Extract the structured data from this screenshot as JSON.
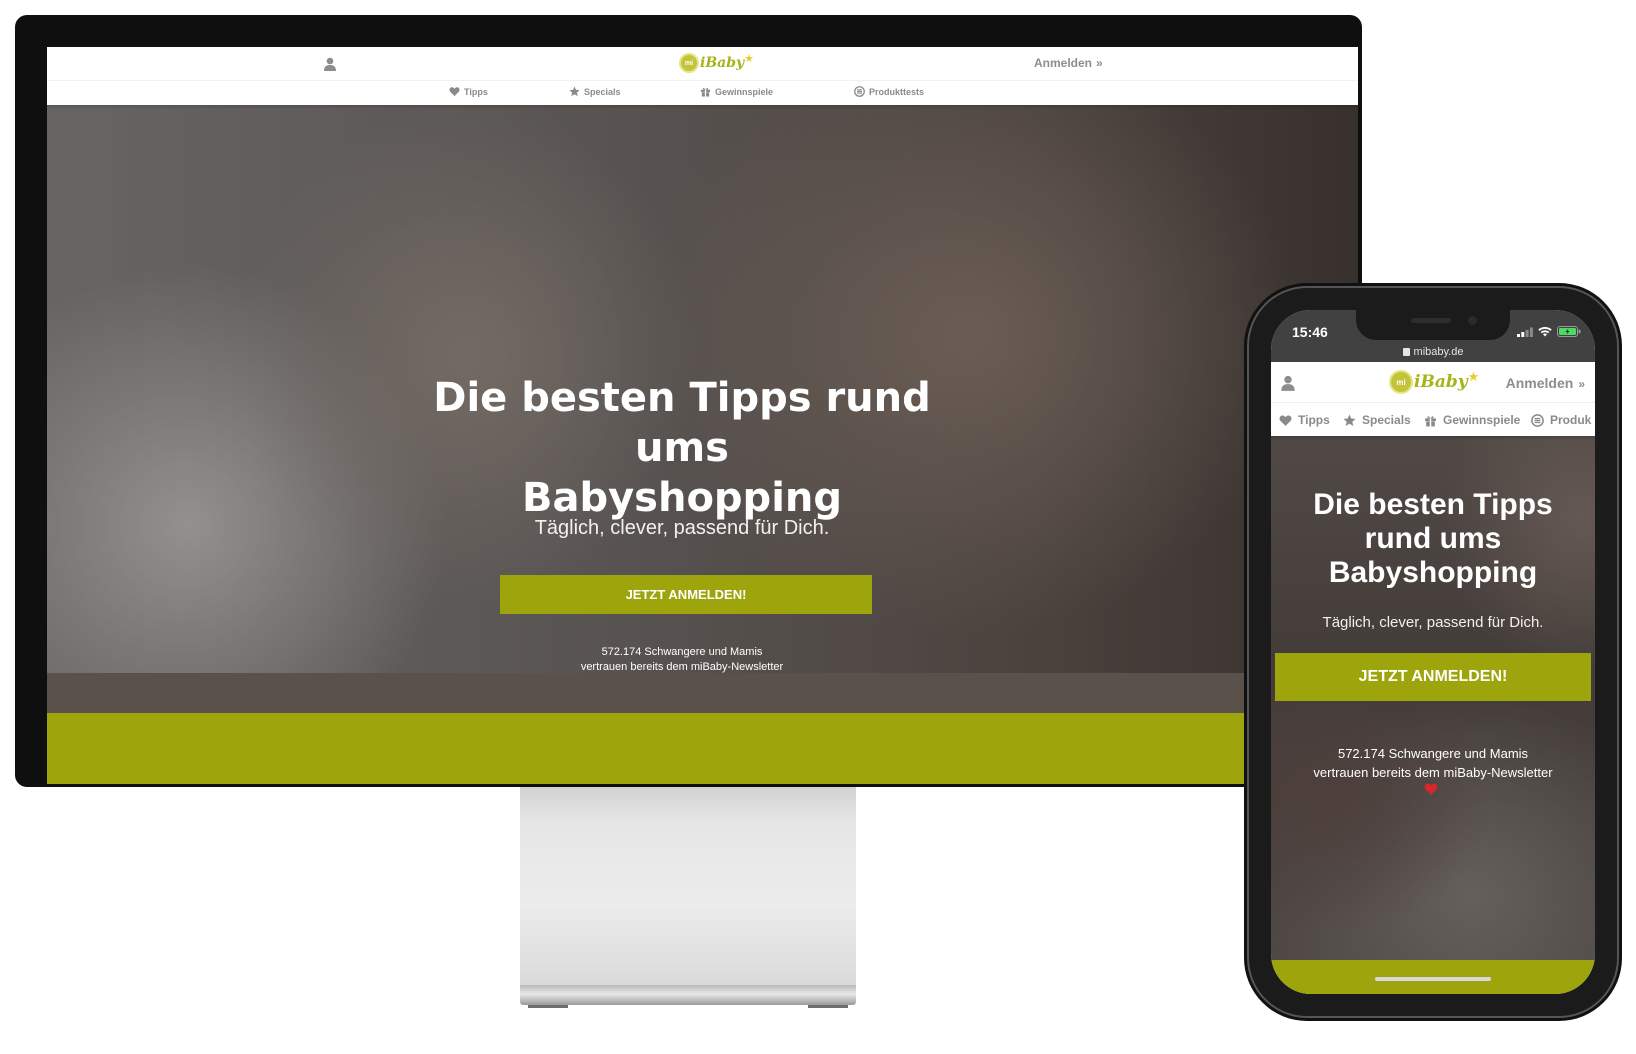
{
  "desktop": {
    "header": {
      "logo_text": "iBaby",
      "logo_badge": "mi",
      "login_label": "Anmelden",
      "login_chevron": "»"
    },
    "nav": [
      {
        "label": "Tipps",
        "icon": "heart-icon"
      },
      {
        "label": "Specials",
        "icon": "star-icon"
      },
      {
        "label": "Gewinnspiele",
        "icon": "gift-icon"
      },
      {
        "label": "Produkttests",
        "icon": "settings-circle-icon"
      }
    ],
    "hero": {
      "title_line1": "Die besten Tipps rund ums",
      "title_line2": "Babyshopping",
      "subtitle": "Täglich, clever, passend für Dich.",
      "cta_label": "JETZT ANMELDEN!",
      "trust_line1": "572.174 Schwangere und Mamis",
      "trust_line2": "vertrauen bereits dem miBaby-Newsletter",
      "scroll_glyph": "▼"
    }
  },
  "phone": {
    "status": {
      "time": "15:46",
      "url": "mibaby.de"
    },
    "header": {
      "logo_text": "iBaby",
      "logo_badge": "mi",
      "login_label": "Anmelden",
      "login_chevron": "»"
    },
    "nav": [
      {
        "label": "Tipps",
        "icon": "heart-icon"
      },
      {
        "label": "Specials",
        "icon": "star-icon"
      },
      {
        "label": "Gewinnspiele",
        "icon": "gift-icon"
      },
      {
        "label": "Produk",
        "icon": "settings-circle-icon"
      }
    ],
    "hero": {
      "title_line1": "Die besten Tipps",
      "title_line2": "rund ums",
      "title_line3": "Babyshopping",
      "subtitle": "Täglich, clever, passend für Dich.",
      "cta_label": "JETZT ANMELDEN!",
      "trust_line1": "572.174 Schwangere und Mamis",
      "trust_line2": "vertrauen bereits dem miBaby-Newsletter"
    }
  },
  "colors": {
    "brand_green": "#9ea50c",
    "logo_green": "#a6b41a",
    "nav_gray": "#8a8a8a",
    "heart_red": "#d9262c"
  }
}
